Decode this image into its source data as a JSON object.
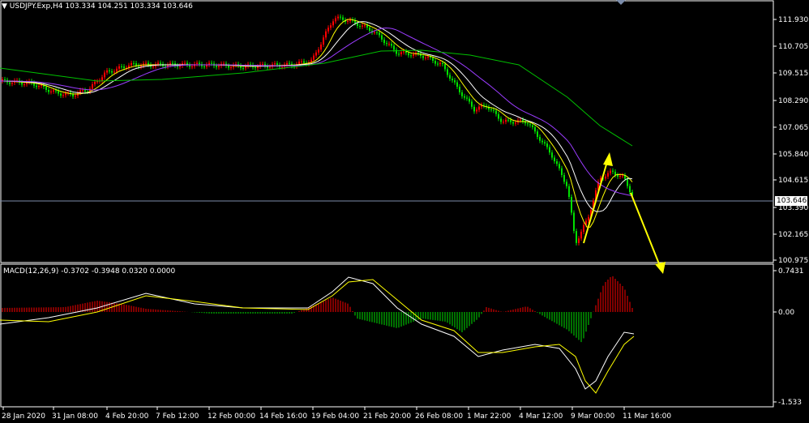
{
  "main_header": "USDJPY.Exp,H4  103.334 104.251 103.334 103.646",
  "macd_header": "MACD(12,26,9) -0.3702 -0.3948 0.0320 0.0000",
  "current_price": "103.646",
  "price_axis": [
    "111.930",
    "110.705",
    "109.515",
    "108.290",
    "107.065",
    "105.840",
    "104.615",
    "103.390",
    "102.165",
    "100.975"
  ],
  "macd_axis": [
    "0.7431",
    "0.00",
    "-1.533"
  ],
  "time_axis": [
    "28 Jan 2020",
    "31 Jan 08:00",
    "4 Feb 20:00",
    "7 Feb 12:00",
    "12 Feb 00:00",
    "14 Feb 16:00",
    "19 Feb 04:00",
    "21 Feb 20:00",
    "26 Feb 08:00",
    "1 Mar 22:00",
    "4 Mar 12:00",
    "9 Mar 00:00",
    "11 Mar 16:00"
  ],
  "colors": {
    "bull": "#ff0000",
    "bear": "#00e000",
    "ma_fast": "#ffff00",
    "ma_mid": "#ffffff",
    "ma_slow": "#9b3cff",
    "ma_long": "#00c000",
    "arrow": "#ffff00"
  }
}
